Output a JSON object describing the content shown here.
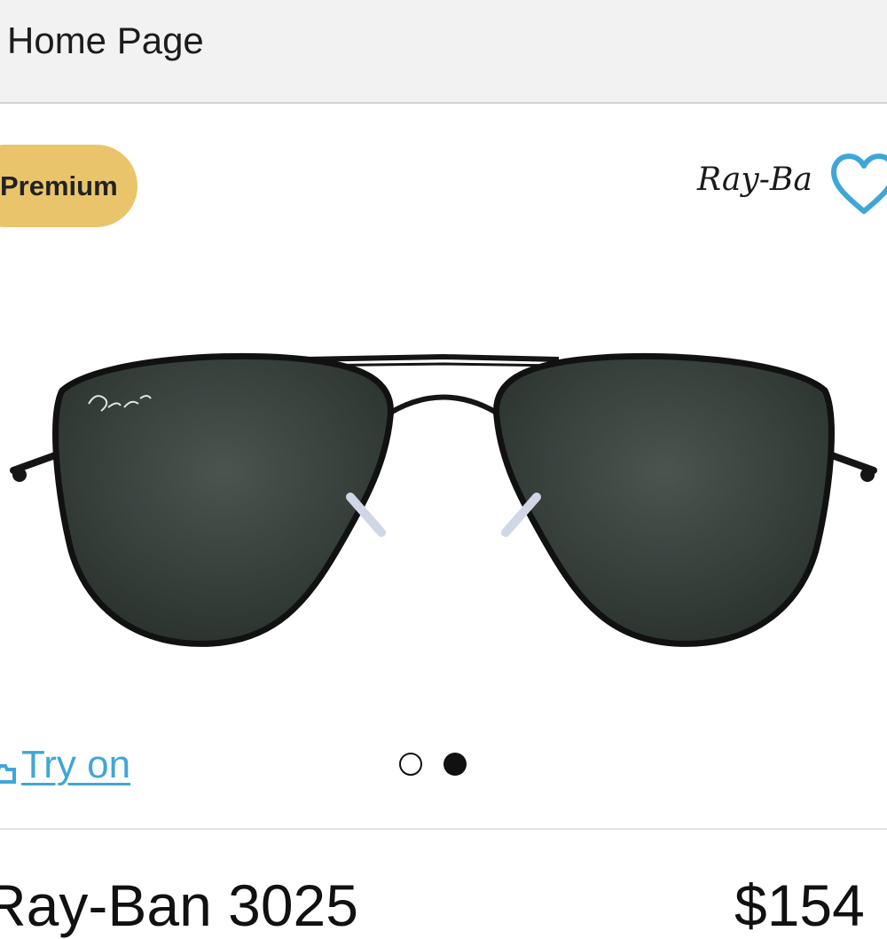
{
  "header": {
    "title": "Home Page"
  },
  "product": {
    "badge": "Premium",
    "brand_logo_text": "Ray-Ban",
    "name": "Ray-Ban 3025",
    "price": "$154"
  },
  "actions": {
    "try_on_label": "Try on"
  },
  "carousel": {
    "slide_count": 2,
    "active_index": 1
  },
  "colors": {
    "badge": "#e9c46a",
    "link": "#3fa6d8",
    "heart": "#3fa6d8",
    "header_bg": "#f2f2f2"
  },
  "icons": {
    "favorite": "heart-outline-icon",
    "try_on": "camera-icon"
  }
}
